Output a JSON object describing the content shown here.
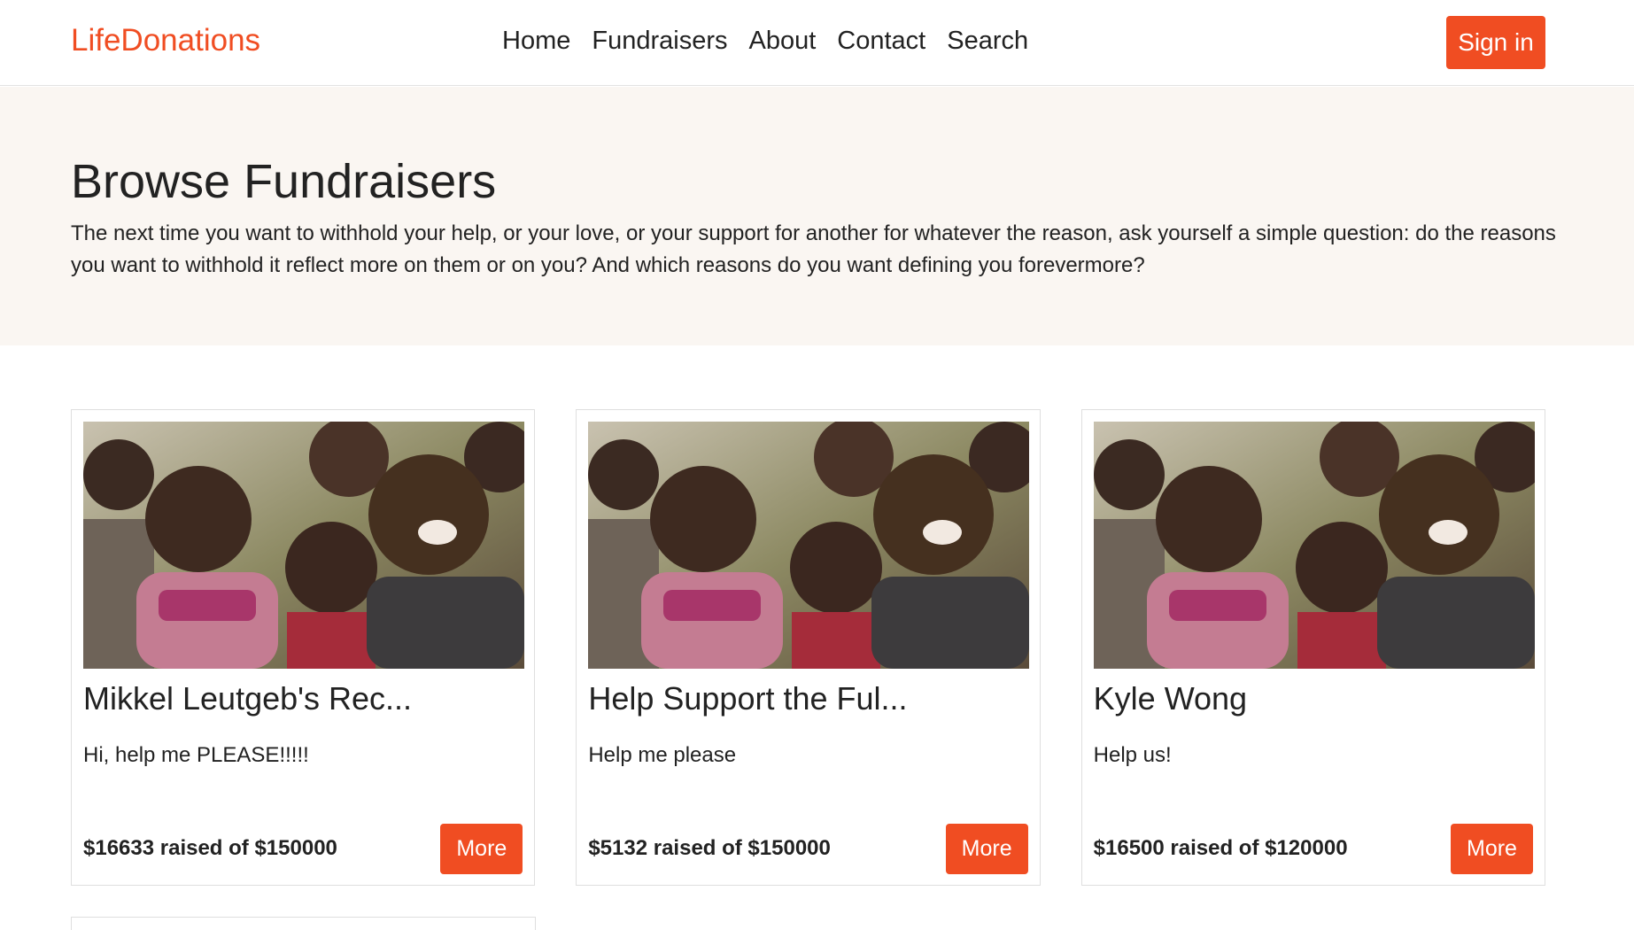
{
  "brand": "LifeDonations",
  "nav": [
    "Home",
    "Fundraisers",
    "About",
    "Contact",
    "Search"
  ],
  "signin_label": "Sign in",
  "hero": {
    "title": "Browse Fundraisers",
    "text": "The next time you want to withhold your help, or your love, or your support for another for whatever the reason, ask yourself a simple question: do the reasons you want to withhold it reflect more on them or on you? And which reasons do you want defining you forevermore?"
  },
  "cards": [
    {
      "title": "Mikkel Leutgeb's Rec...",
      "description": "Hi, help me PLEASE!!!!!",
      "raised": "$16633 raised of $150000",
      "button": "More"
    },
    {
      "title": "Help Support the Ful...",
      "description": "Help me please",
      "raised": "$5132 raised of $150000",
      "button": "More"
    },
    {
      "title": "Kyle Wong",
      "description": "Help us!",
      "raised": "$16500 raised of $120000",
      "button": "More"
    }
  ],
  "colors": {
    "accent": "#f04d22",
    "hero_bg": "#faf6f2",
    "text": "#222222"
  },
  "icons": [
    "children-photo"
  ]
}
